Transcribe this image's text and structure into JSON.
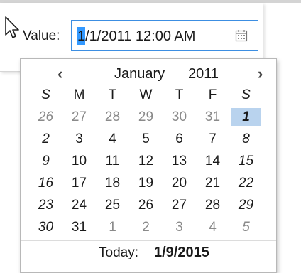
{
  "value_field": {
    "label": "Value:",
    "value": "1/1/2011 12:00 AM",
    "icons": {
      "pointer": "mouse-pointer-icon",
      "calendar": "calendar-icon"
    }
  },
  "calendar": {
    "prev_label": "‹",
    "next_label": "›",
    "month": "January",
    "year": "2011",
    "weekdays": [
      "S",
      "M",
      "T",
      "W",
      "T",
      "F",
      "S"
    ],
    "weeks": [
      [
        {
          "d": "26",
          "other": true
        },
        {
          "d": "27",
          "other": true
        },
        {
          "d": "28",
          "other": true
        },
        {
          "d": "29",
          "other": true
        },
        {
          "d": "30",
          "other": true
        },
        {
          "d": "31",
          "other": true
        },
        {
          "d": "1",
          "selected": true
        }
      ],
      [
        {
          "d": "2"
        },
        {
          "d": "3"
        },
        {
          "d": "4"
        },
        {
          "d": "5"
        },
        {
          "d": "6"
        },
        {
          "d": "7"
        },
        {
          "d": "8"
        }
      ],
      [
        {
          "d": "9"
        },
        {
          "d": "10"
        },
        {
          "d": "11"
        },
        {
          "d": "12"
        },
        {
          "d": "13"
        },
        {
          "d": "14"
        },
        {
          "d": "15"
        }
      ],
      [
        {
          "d": "16"
        },
        {
          "d": "17"
        },
        {
          "d": "18"
        },
        {
          "d": "19"
        },
        {
          "d": "20"
        },
        {
          "d": "21"
        },
        {
          "d": "22"
        }
      ],
      [
        {
          "d": "23"
        },
        {
          "d": "24"
        },
        {
          "d": "25"
        },
        {
          "d": "26"
        },
        {
          "d": "27"
        },
        {
          "d": "28"
        },
        {
          "d": "29"
        }
      ],
      [
        {
          "d": "30"
        },
        {
          "d": "31"
        },
        {
          "d": "1",
          "other": true
        },
        {
          "d": "2",
          "other": true
        },
        {
          "d": "3",
          "other": true
        },
        {
          "d": "4",
          "other": true
        },
        {
          "d": "5",
          "other": true
        }
      ]
    ],
    "today_label": "Today:",
    "today_value": "1/9/2015",
    "colors": {
      "selected": "#b9d3ee",
      "focus_border": "#3c8ee2",
      "other_month_text": "#8a8a8a"
    }
  }
}
